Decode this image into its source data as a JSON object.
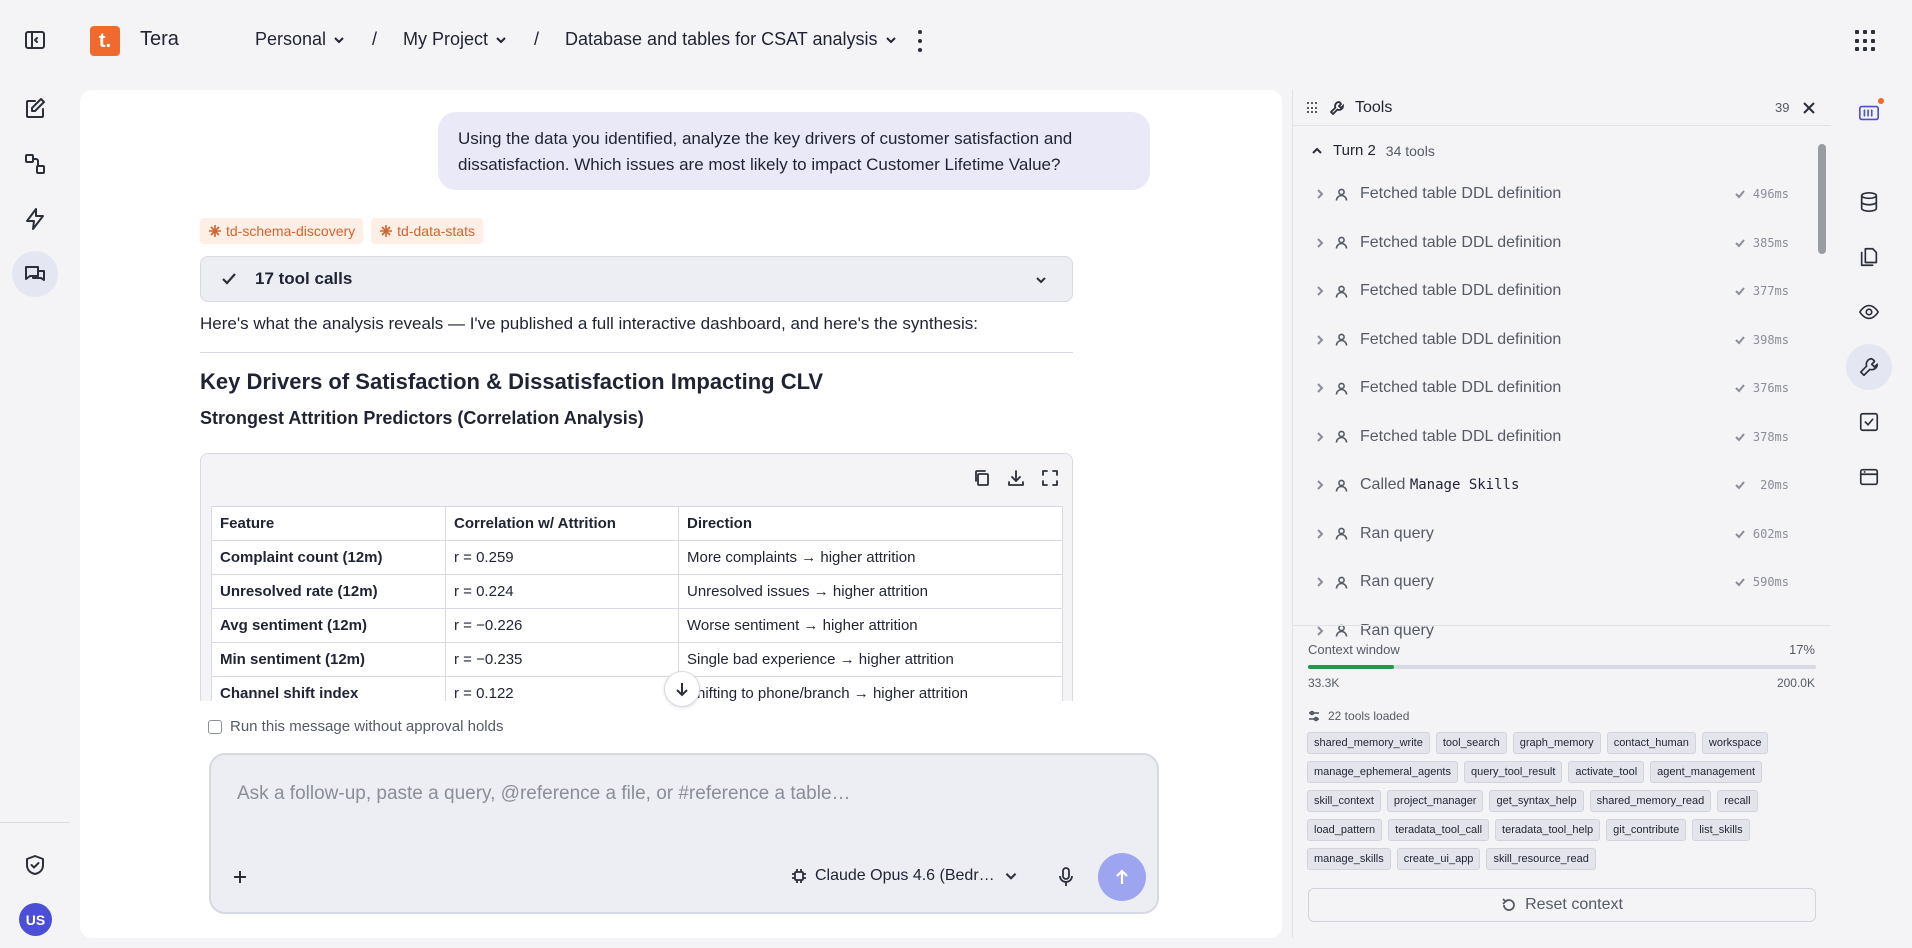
{
  "app": {
    "logo_letter": "t.",
    "name": "Tera"
  },
  "breadcrumb": {
    "workspace": "Personal",
    "project": "My Project",
    "separator": "/",
    "thread": "Database and tables for CSAT analysis"
  },
  "chat": {
    "user_message": "Using the data you identified, analyze the key drivers of customer satisfaction and dissatisfaction. Which issues are most likely to impact Customer Lifetime Value?",
    "skills": [
      "td-schema-discovery",
      "td-data-stats"
    ],
    "tool_calls_label": "17 tool calls",
    "intro": "Here's what the analysis reveals — I've published a full interactive dashboard, and here's the synthesis:",
    "heading": "Key Drivers of Satisfaction & Dissatisfaction Impacting CLV",
    "subheading": "Strongest Attrition Predictors (Correlation Analysis)",
    "table": {
      "headers": [
        "Feature",
        "Correlation w/ Attrition",
        "Direction"
      ],
      "rows": [
        [
          "Complaint count (12m)",
          "r = 0.259",
          "More complaints → higher attrition"
        ],
        [
          "Unresolved rate (12m)",
          "r = 0.224",
          "Unresolved issues → higher attrition"
        ],
        [
          "Avg sentiment (12m)",
          "r = −0.226",
          "Worse sentiment → higher attrition"
        ],
        [
          "Min sentiment (12m)",
          "r = −0.235",
          "Single bad experience → higher attrition"
        ],
        [
          "Channel shift index",
          "r = 0.122",
          "Shifting to phone/branch → higher attrition"
        ]
      ]
    },
    "approval_label": "Run this message without approval holds",
    "composer_placeholder": "Ask a follow-up, paste a query, @reference a file, or #reference a table…",
    "model": "Claude Opus 4.6 (Bedr…"
  },
  "tools_panel": {
    "title": "Tools",
    "count": "39",
    "turn_label": "Turn 2",
    "turn_sub": "34 tools",
    "rows": [
      {
        "name": "Fetched table DDL definition",
        "code": "",
        "duration": "496ms"
      },
      {
        "name": "Fetched table DDL definition",
        "code": "",
        "duration": "385ms"
      },
      {
        "name": "Fetched table DDL definition",
        "code": "",
        "duration": "377ms"
      },
      {
        "name": "Fetched table DDL definition",
        "code": "",
        "duration": "398ms"
      },
      {
        "name": "Fetched table DDL definition",
        "code": "",
        "duration": "376ms"
      },
      {
        "name": "Fetched table DDL definition",
        "code": "",
        "duration": "378ms"
      },
      {
        "name": "Called",
        "code": "Manage Skills",
        "duration": "20ms"
      },
      {
        "name": "Ran query",
        "code": "",
        "duration": "602ms"
      },
      {
        "name": "Ran query",
        "code": "",
        "duration": "590ms"
      },
      {
        "name": "Ran query",
        "code": "",
        "duration": ""
      }
    ],
    "context_label": "Context window",
    "context_pct": "17%",
    "context_fraction": 0.17,
    "context_used": "33.3K",
    "context_max": "200.0K",
    "loaded_label": "22 tools loaded",
    "loaded_tools": [
      "shared_memory_write",
      "tool_search",
      "graph_memory",
      "contact_human",
      "workspace",
      "manage_ephemeral_agents",
      "query_tool_result",
      "activate_tool",
      "agent_management",
      "skill_context",
      "project_manager",
      "get_syntax_help",
      "shared_memory_read",
      "recall",
      "load_pattern",
      "teradata_tool_call",
      "teradata_tool_help",
      "git_contribute",
      "list_skills",
      "manage_skills",
      "create_ui_app",
      "skill_resource_read"
    ],
    "reset_label": "Reset context"
  },
  "user": {
    "initials": "US"
  },
  "colors": {
    "brand": "#ef6a2c",
    "accent": "#4b4fd6",
    "progress": "#1f9a4a"
  }
}
